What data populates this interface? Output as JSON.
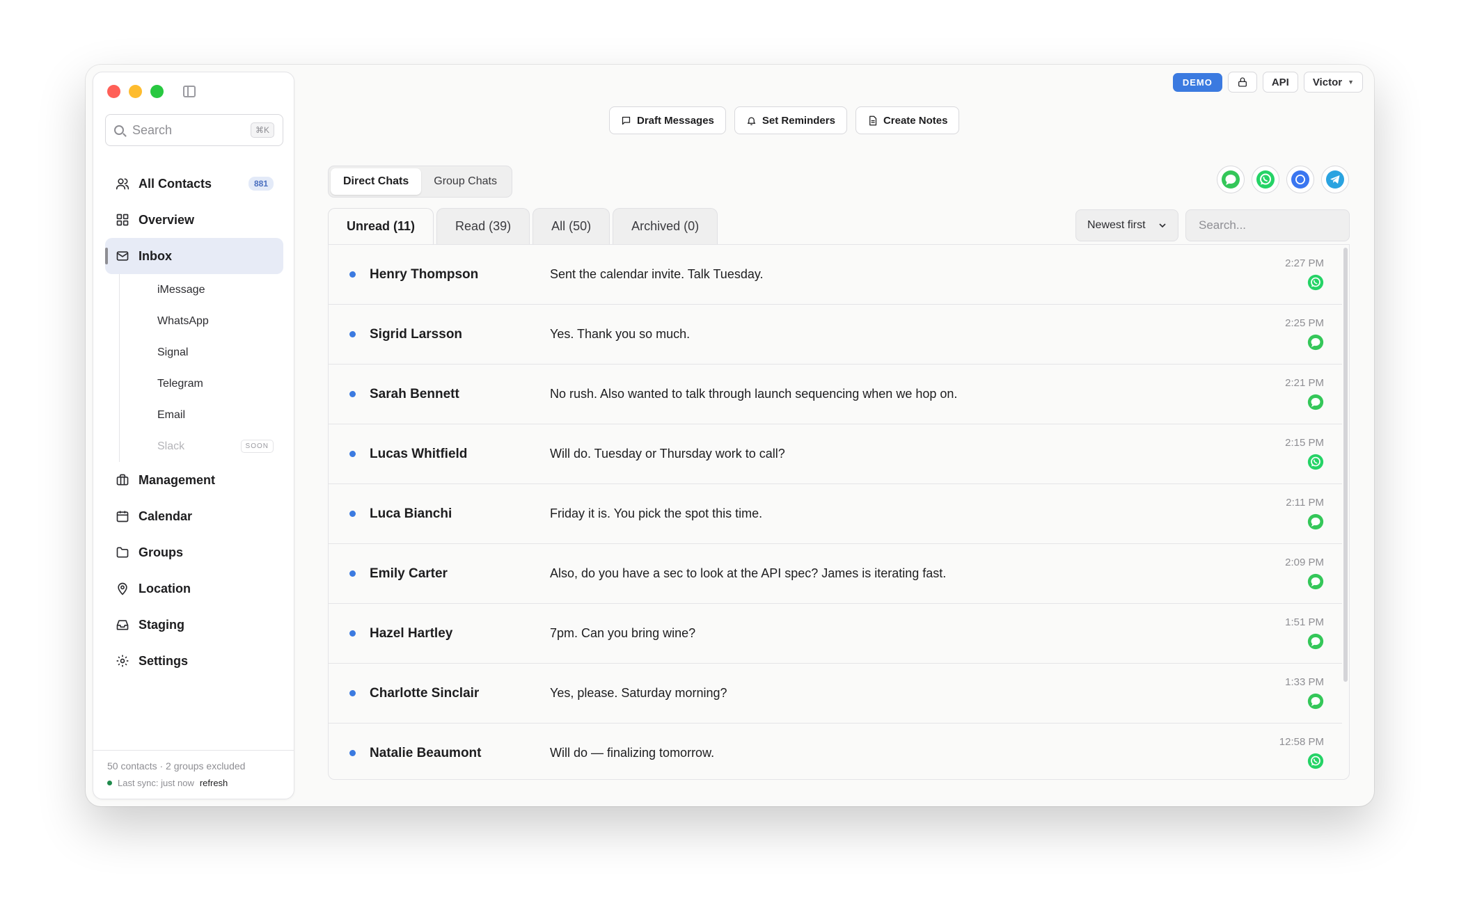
{
  "sidebar": {
    "search_placeholder": "Search",
    "search_shortcut": "⌘K",
    "nav": [
      {
        "label": "All Contacts",
        "icon": "users-icon",
        "badge": "881"
      },
      {
        "label": "Overview",
        "icon": "grid-icon"
      },
      {
        "label": "Inbox",
        "icon": "mail-icon",
        "active": true
      }
    ],
    "inbox_sub": [
      {
        "label": "iMessage"
      },
      {
        "label": "WhatsApp"
      },
      {
        "label": "Signal"
      },
      {
        "label": "Telegram"
      },
      {
        "label": "Email"
      },
      {
        "label": "Slack",
        "disabled": true,
        "tag": "SOON"
      }
    ],
    "nav_bottom": [
      {
        "label": "Management",
        "icon": "briefcase-icon"
      },
      {
        "label": "Calendar",
        "icon": "calendar-icon"
      },
      {
        "label": "Groups",
        "icon": "folder-icon"
      },
      {
        "label": "Location",
        "icon": "map-pin-icon"
      },
      {
        "label": "Staging",
        "icon": "inbox-tray-icon"
      },
      {
        "label": "Settings",
        "icon": "gear-icon"
      }
    ],
    "footer": {
      "summary": "50 contacts · 2 groups excluded",
      "sync": "Last sync: just now",
      "refresh": "refresh"
    }
  },
  "topbar": {
    "demo": "DEMO",
    "api": "API",
    "user": "Victor"
  },
  "actions": {
    "draft": "Draft Messages",
    "reminders": "Set Reminders",
    "notes": "Create Notes"
  },
  "chat_type": {
    "direct": "Direct Chats",
    "group": "Group Chats"
  },
  "tabs": {
    "unread": "Unread (11)",
    "read": "Read (39)",
    "all": "All (50)",
    "archived": "Archived (0)"
  },
  "sort": {
    "selected": "Newest first"
  },
  "message_search": {
    "placeholder": "Search..."
  },
  "colors": {
    "accent": "#3b7ae0",
    "imessage": "#34c759",
    "whatsapp": "#25d366",
    "signal": "#3a76f0",
    "telegram": "#2aa3e0"
  },
  "messages": [
    {
      "name": "Henry Thompson",
      "preview": "Sent the calendar invite. Talk Tuesday.",
      "time": "2:27 PM",
      "channel": "whatsapp"
    },
    {
      "name": "Sigrid Larsson",
      "preview": "Yes. Thank you so much.",
      "time": "2:25 PM",
      "channel": "imessage"
    },
    {
      "name": "Sarah Bennett",
      "preview": "No rush. Also wanted to talk through launch sequencing when we hop on.",
      "time": "2:21 PM",
      "channel": "imessage"
    },
    {
      "name": "Lucas Whitfield",
      "preview": "Will do. Tuesday or Thursday work to call?",
      "time": "2:15 PM",
      "channel": "whatsapp"
    },
    {
      "name": "Luca Bianchi",
      "preview": "Friday it is. You pick the spot this time.",
      "time": "2:11 PM",
      "channel": "imessage"
    },
    {
      "name": "Emily Carter",
      "preview": "Also, do you have a sec to look at the API spec? James is iterating fast.",
      "time": "2:09 PM",
      "channel": "imessage"
    },
    {
      "name": "Hazel Hartley",
      "preview": "7pm. Can you bring wine?",
      "time": "1:51 PM",
      "channel": "imessage"
    },
    {
      "name": "Charlotte Sinclair",
      "preview": "Yes, please. Saturday morning?",
      "time": "1:33 PM",
      "channel": "imessage"
    },
    {
      "name": "Natalie Beaumont",
      "preview": "Will do — finalizing tomorrow.",
      "time": "12:58 PM",
      "channel": "whatsapp"
    }
  ]
}
